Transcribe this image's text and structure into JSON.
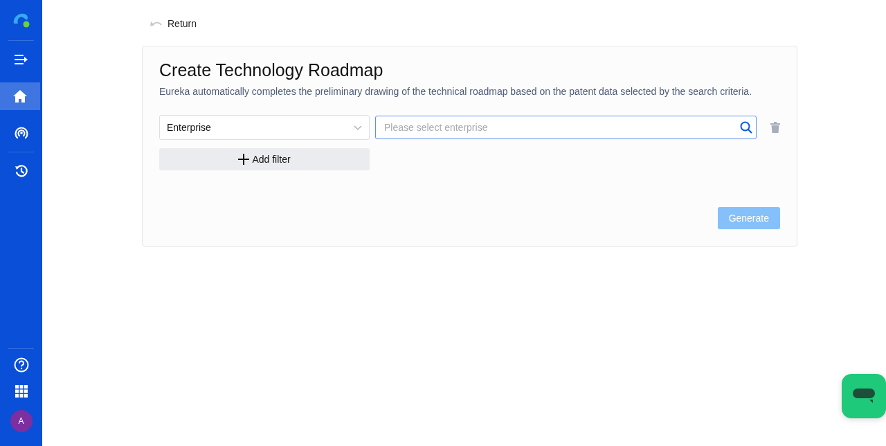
{
  "sidebar": {
    "nav_items": [
      {
        "kind": "expand",
        "selected": false
      },
      {
        "kind": "home",
        "selected": true
      },
      {
        "kind": "signal",
        "selected": false
      },
      {
        "kind": "history",
        "selected": false
      }
    ],
    "avatar": "A"
  },
  "return_link": "Return",
  "card": {
    "title": "Create Technology Roadmap",
    "description": "Eureka automatically completes the preliminary drawing of the technical roadmap based on the patent data selected by the search criteria.",
    "filter": {
      "type_select": "Enterprise",
      "search": {
        "placeholder": "Please select enterprise"
      }
    },
    "add_filter": "Add filter",
    "generate": {
      "label": "Generate",
      "disabled": true
    }
  }
}
